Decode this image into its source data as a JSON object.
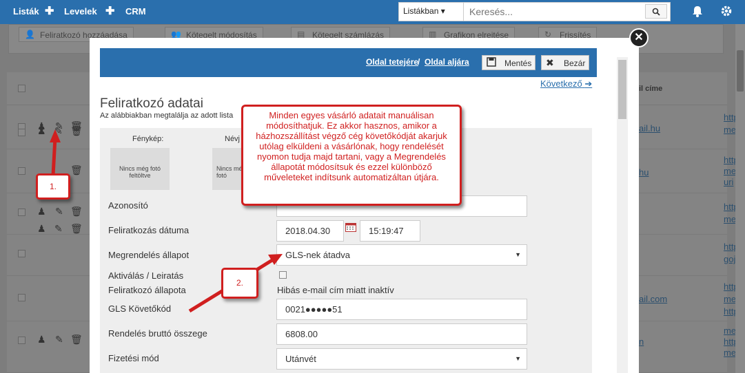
{
  "topnav": {
    "items": [
      "Listák",
      "Levelek",
      "CRM"
    ],
    "search_scope": "Listákban ▾",
    "search_placeholder": "Keresés...",
    "search_icon": "search-icon",
    "bell_icon": "bell-icon",
    "settings_icon": "gear-icon"
  },
  "background": {
    "toolbar": [
      "Feliratkozó hozzáadása",
      "Kötegelt módosítás",
      "Kötegelt számlázás",
      "Grafikon elrejtése",
      "Frissítés"
    ],
    "column_email": "il címe",
    "row_fragments": [
      "ail.hu",
      "hu",
      "ail.com",
      "n"
    ],
    "link_fragments": [
      "http",
      "me",
      "http",
      "me",
      "uri",
      "http",
      "me",
      "http",
      "goj",
      "http",
      "me",
      "http",
      "me",
      "http",
      "me"
    ]
  },
  "modal": {
    "header_link_top": "Oldal tetejére",
    "separator": "/",
    "header_link_bottom": "Oldal aljára",
    "save_label": "Mentés",
    "close_label": "Bezár",
    "next_label": "Következő",
    "title": "Feliratkozó adatai",
    "subtitle": "Az alábbiakban megtalálja az adott lista",
    "photo_label": "Fénykép:",
    "photo_empty": "Nincs még fotó feltöltve",
    "signature_label": "Névj",
    "signature_empty": "Nincs még fotó",
    "fields": {
      "id_label": "Azonosító",
      "id_value": "",
      "date_label": "Feliratkozás dátuma",
      "date_value": "2018.04.30",
      "time_value": "15:19:47",
      "order_status_label": "Megrendelés állapot",
      "order_status_value": "GLS-nek átadva",
      "activation_label": "Aktiválás / Leiratás",
      "subscriber_status_label": "Feliratkozó állapota",
      "subscriber_status_value": "Hibás e-mail cím miatt inaktív",
      "gls_label": "GLS Követőkód",
      "gls_value": "0021●●●●●51",
      "gross_label": "Rendelés bruttó összege",
      "gross_value": "6808.00",
      "payment_label": "Fizetési mód",
      "payment_value": "Utánvét"
    }
  },
  "annotations": {
    "callout": "Minden egyes vásárló adatait manuálisan módosíthatjuk. Ez akkor hasznos, amikor a házhozszállítást végző cég követőkódját akarjuk utólag elküldeni a vásárlónak, hogy rendelését nyomon tudja majd tartani, vagy a Megrendelés állapotát módosítsuk és ezzel különböző műveleteket indítsunk automatizáltan útjára.",
    "step1": "1.",
    "step2": "2.",
    "color": "#d01f1f"
  }
}
